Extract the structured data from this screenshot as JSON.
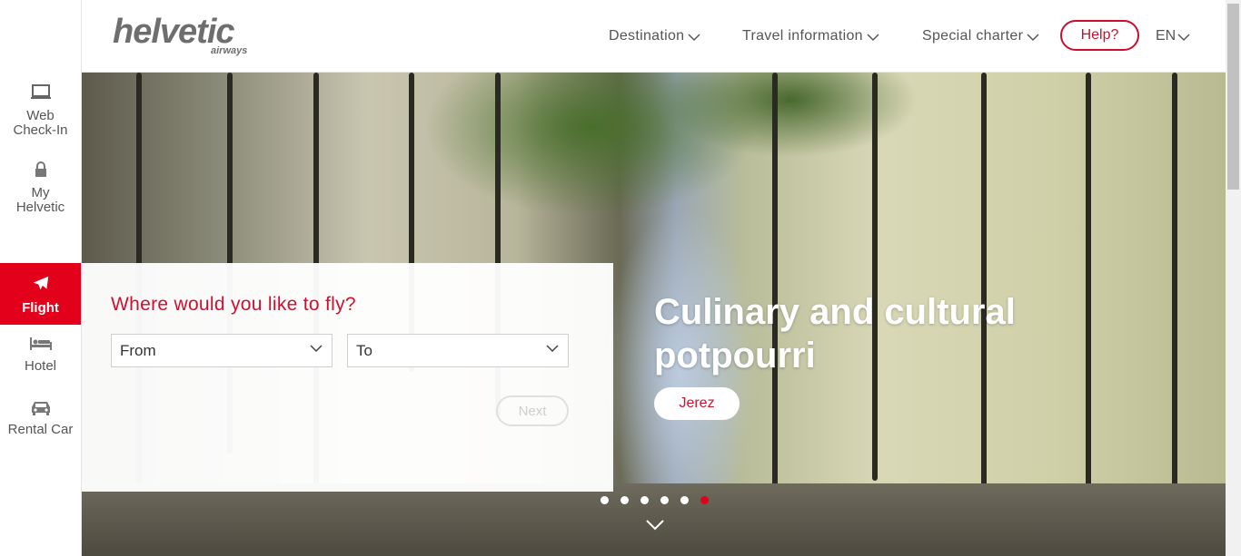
{
  "brand": {
    "logo_main": "helvetic",
    "logo_sub": "airways"
  },
  "sidebar": {
    "items": [
      {
        "label_line1": "Web",
        "label_line2": "Check-In",
        "icon": "laptop-icon",
        "active": false
      },
      {
        "label_line1": "My",
        "label_line2": "Helvetic",
        "icon": "lock-icon",
        "active": false
      },
      {
        "label": "Flight",
        "icon": "plane-icon",
        "active": true
      },
      {
        "label": "Hotel",
        "icon": "bed-icon",
        "active": false
      },
      {
        "label": "Rental Car",
        "icon": "car-icon",
        "active": false
      }
    ]
  },
  "header": {
    "nav": [
      {
        "label": "Destination"
      },
      {
        "label": "Travel information"
      },
      {
        "label": "Special charter"
      }
    ],
    "help_label": "Help?",
    "language": "EN"
  },
  "search": {
    "title": "Where would you like to fly?",
    "from_value": "From",
    "to_value": "To",
    "next_label": "Next"
  },
  "hero": {
    "headline": "Culinary and cultural potpourri",
    "tag": "Jerez",
    "dots_total": 6,
    "active_dot": 6
  },
  "colors": {
    "brand_red": "#e2001a",
    "text_gray": "#555555"
  }
}
